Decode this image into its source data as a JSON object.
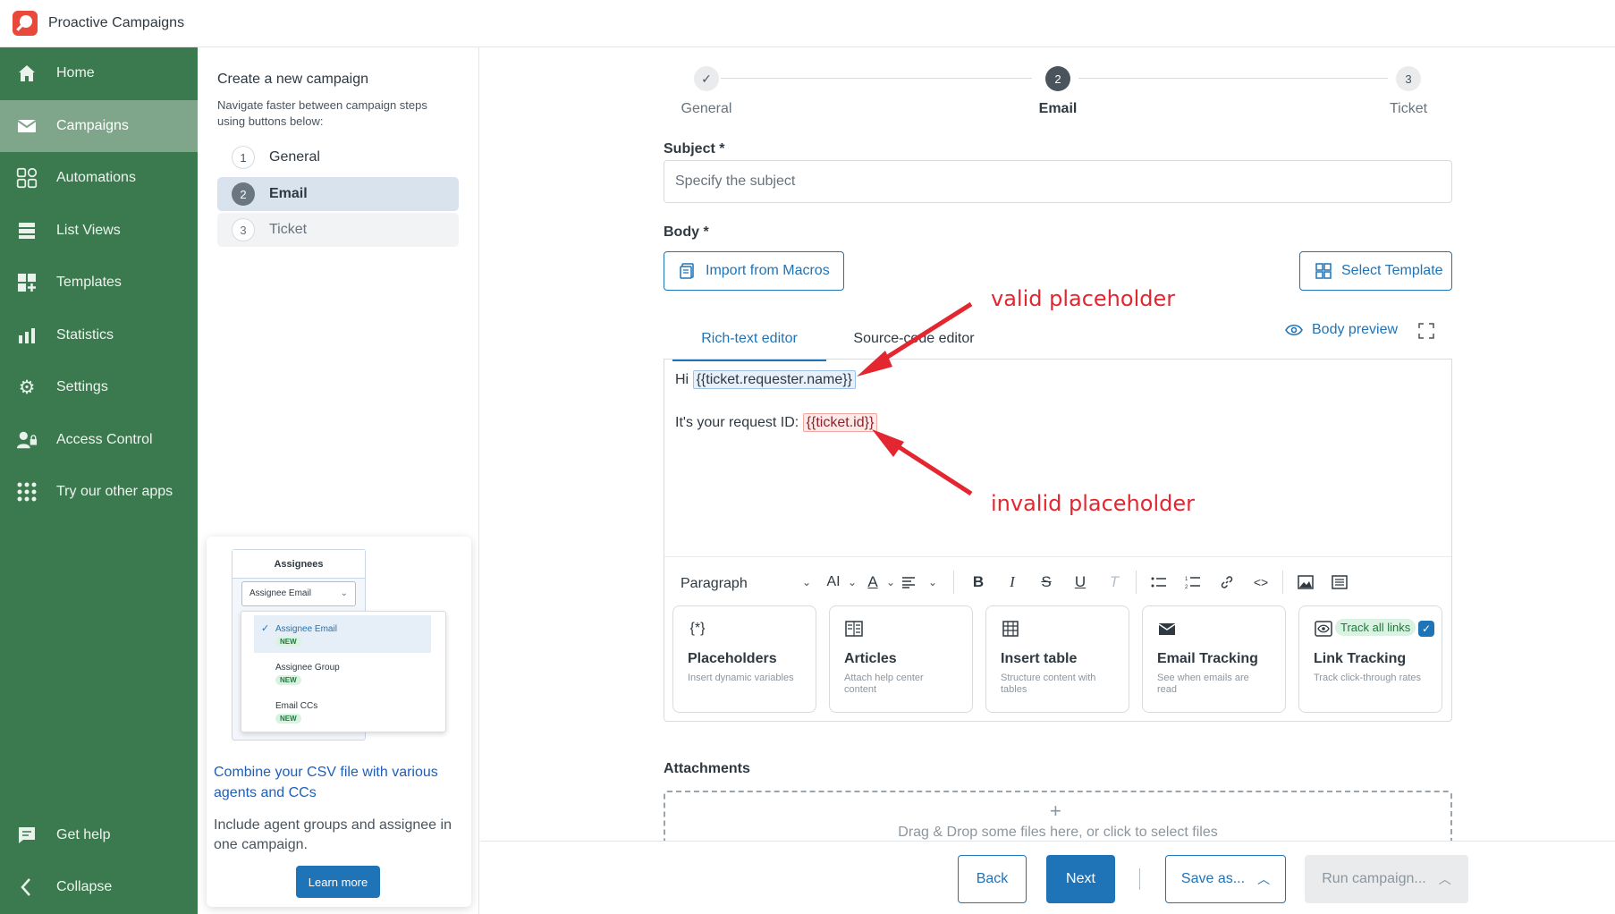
{
  "app": {
    "title": "Proactive Campaigns"
  },
  "nav": {
    "items": [
      {
        "label": "Home",
        "icon": "home-icon"
      },
      {
        "label": "Campaigns",
        "icon": "envelope-icon"
      },
      {
        "label": "Automations",
        "icon": "shapes-icon"
      },
      {
        "label": "List Views",
        "icon": "list-icon"
      },
      {
        "label": "Templates",
        "icon": "templates-icon"
      },
      {
        "label": "Statistics",
        "icon": "bar-chart-icon"
      },
      {
        "label": "Settings",
        "icon": "gear-icon"
      },
      {
        "label": "Access Control",
        "icon": "user-lock-icon"
      },
      {
        "label": "Try our other apps",
        "icon": "apps-grid-icon"
      }
    ],
    "help": "Get help",
    "collapse": "Collapse"
  },
  "steps_panel": {
    "title": "Create a new campaign",
    "description": "Navigate faster between campaign steps using buttons below:",
    "steps": [
      {
        "num": "1",
        "label": "General"
      },
      {
        "num": "2",
        "label": "Email"
      },
      {
        "num": "3",
        "label": "Ticket"
      }
    ]
  },
  "promo": {
    "mock_header": "Assignees",
    "mock_select": "Assignee Email",
    "mock_options": [
      {
        "label": "Assignee Email",
        "badge": "NEW"
      },
      {
        "label": "Assignee Group",
        "badge": "NEW"
      },
      {
        "label": "Email CCs",
        "badge": "NEW"
      }
    ],
    "title": "Combine your CSV file with various agents and CCs",
    "text": "Include agent groups and assignee in one campaign.",
    "button": "Learn more"
  },
  "stepper": {
    "steps": [
      {
        "num": "✓",
        "label": "General"
      },
      {
        "num": "2",
        "label": "Email"
      },
      {
        "num": "3",
        "label": "Ticket"
      }
    ]
  },
  "form": {
    "subject_label": "Subject *",
    "subject_placeholder": "Specify the subject",
    "subject_value": "",
    "body_label": "Body *",
    "import_macros": "Import from Macros",
    "select_template": "Select Template",
    "tabs": [
      "Rich-text editor",
      "Source-code editor"
    ],
    "body_preview": "Body preview",
    "editor": {
      "line1_prefix": "Hi",
      "line1_placeholder": "{{ticket.requester.name}}",
      "line2_prefix": "It's your request ID:",
      "line2_placeholder": "{{ticket.id}}"
    },
    "toolbar": {
      "paragraph": "Paragraph"
    },
    "features": [
      {
        "title": "Placeholders",
        "desc": "Insert dynamic variables",
        "icon": "braces-asterisk-icon"
      },
      {
        "title": "Articles",
        "desc": "Attach help center content",
        "icon": "article-icon"
      },
      {
        "title": "Insert table",
        "desc": "Structure content with tables",
        "icon": "table-icon"
      },
      {
        "title": "Email Tracking",
        "desc": "See when emails are read",
        "icon": "email-open-icon"
      },
      {
        "title": "Link Tracking",
        "desc": "Track click-through rates",
        "icon": "eye-tracking-icon",
        "pill": "Track all links"
      }
    ],
    "attachments_label": "Attachments",
    "dropzone_text": "Drag & Drop some files here, or click to select files"
  },
  "footer": {
    "back": "Back",
    "next": "Next",
    "save_as": "Save as...",
    "run_campaign": "Run campaign..."
  },
  "annotations": {
    "valid": "valid placeholder",
    "invalid": "invalid placeholder",
    "color": "#e3262f"
  }
}
